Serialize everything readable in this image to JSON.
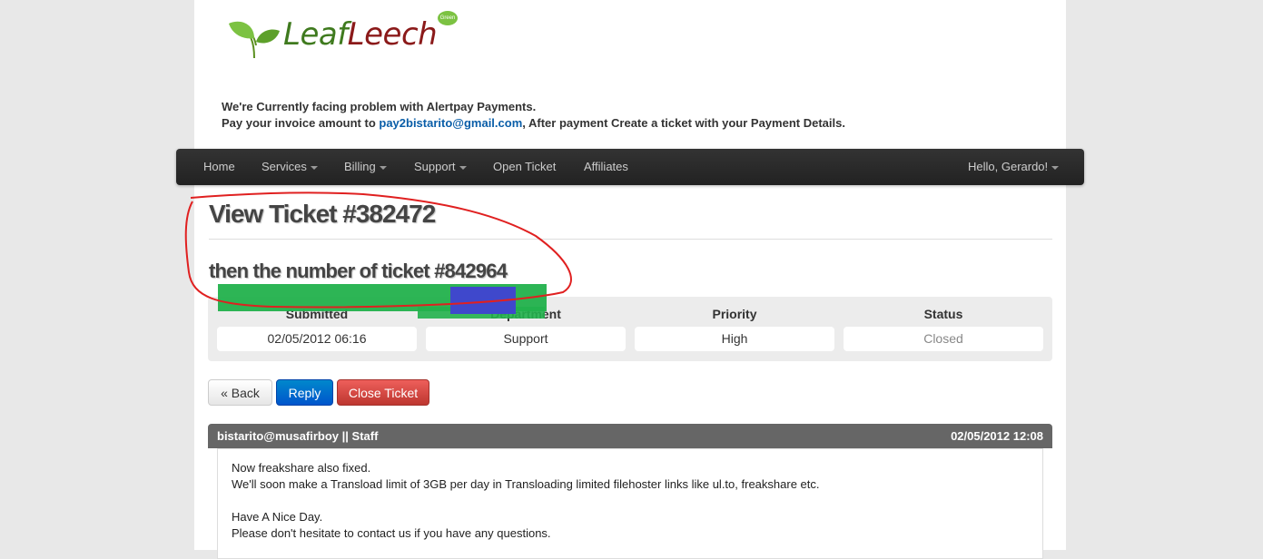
{
  "logo": {
    "text_green": "Leaf",
    "text_red": "Leech",
    "badge": "Green"
  },
  "notice": {
    "line1": "We're Currently facing problem with Alertpay Payments.",
    "line2_pre": "Pay your invoice amount to ",
    "email": "pay2bistarito@gmail.com",
    "line2_post": ", After payment Create a ticket with your Payment Details."
  },
  "nav": {
    "home": "Home",
    "services": "Services",
    "billing": "Billing",
    "support": "Support",
    "open_ticket": "Open Ticket",
    "affiliates": "Affiliates",
    "user": "Hello, Gerardo!"
  },
  "page": {
    "title": "View Ticket #382472",
    "subtitle": "then the number of ticket #842964"
  },
  "ticket_info": [
    {
      "label": "Submitted",
      "value": "02/05/2012 06:16"
    },
    {
      "label": "Department",
      "value": "Support"
    },
    {
      "label": "Priority",
      "value": "High"
    },
    {
      "label": "Status",
      "value": "Closed"
    }
  ],
  "buttons": {
    "back": "« Back",
    "reply": "Reply",
    "close": "Close Ticket"
  },
  "message": {
    "from": "bistarito@musafirboy || Staff",
    "date": "02/05/2012 12:08",
    "lines": [
      "Now freakshare also fixed.",
      "We'll soon make a Transload limit of 3GB per day in Transloading limited filehoster links like ul.to, freakshare etc.",
      "Have A Nice Day.",
      "Please don't hesitate to contact us if you have any questions."
    ]
  },
  "colors": {
    "navbar": "#222222",
    "reply_button": "#0070cc",
    "close_button": "#d9534f",
    "annotation_circle": "#e02020",
    "highlight_green": "#22b14c",
    "highlight_blue": "#3f48cc"
  }
}
